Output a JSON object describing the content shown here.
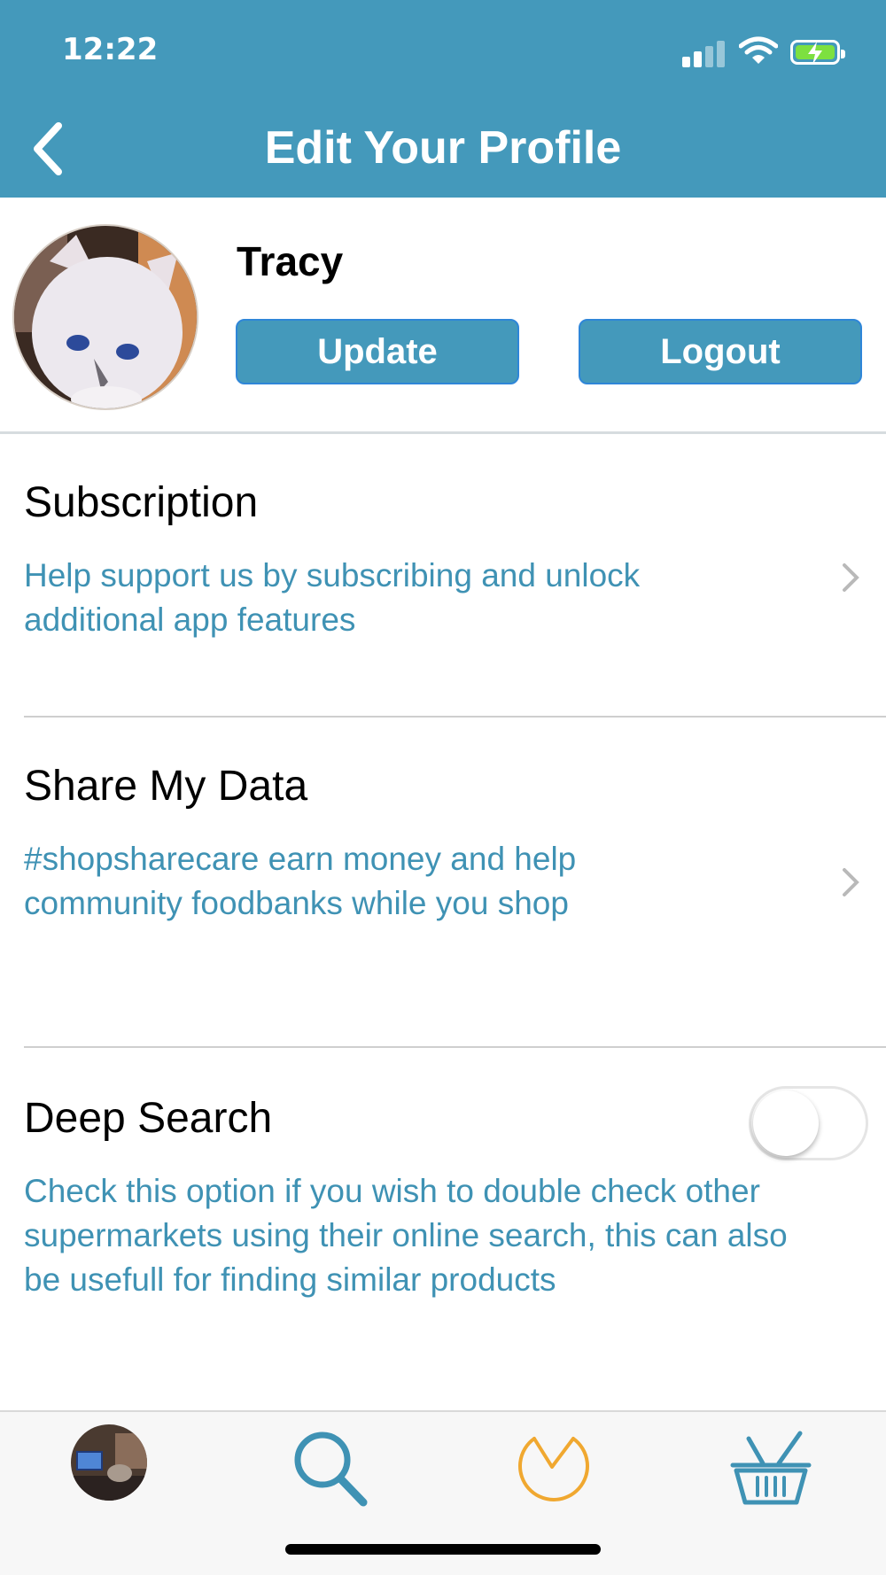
{
  "status_bar": {
    "time": "12:22"
  },
  "header": {
    "title": "Edit Your Profile"
  },
  "profile": {
    "name": "Tracy",
    "update_label": "Update",
    "logout_label": "Logout"
  },
  "settings": [
    {
      "title": "Subscription",
      "description": "Help support us by subscribing and unlock additional app features"
    },
    {
      "title": "Share My Data",
      "description": "#shopsharecare earn money and help community foodbanks while you shop"
    },
    {
      "title": "Deep Search",
      "description": "Check this option if you wish to double check other supermarkets using their online search, this can also be usefull for finding similar products",
      "toggle_on": false
    }
  ],
  "colors": {
    "brand": "#4499bb",
    "link_text": "#3f92b4",
    "accent_orange": "#f0a830"
  },
  "tabbar": {
    "items": [
      "avatar",
      "search-icon",
      "timer-icon",
      "basket-icon"
    ]
  }
}
